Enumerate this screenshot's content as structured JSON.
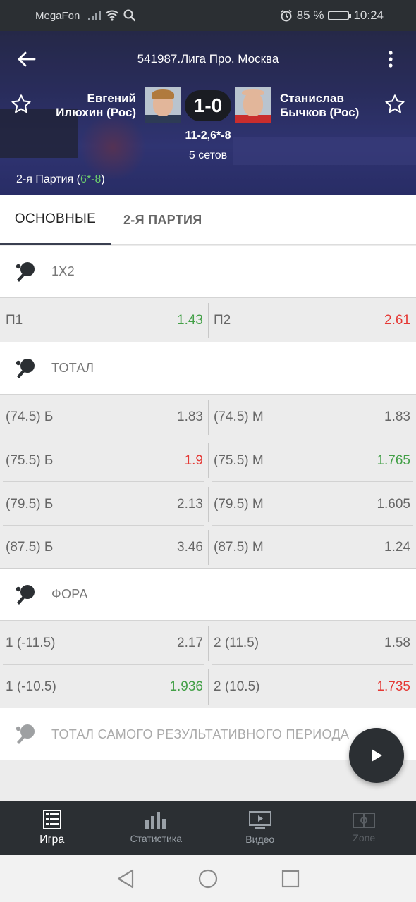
{
  "status_bar": {
    "carrier": "MegaFon",
    "battery": "85 %",
    "time": "10:24",
    "battery_level": 0.85
  },
  "header": {
    "title": "541987.Лига Про. Москва",
    "team1_line1": "Евгений",
    "team1_line2": "Илюхин (Рос)",
    "team2_line1": "Станислав",
    "team2_line2": "Бычков (Рос)",
    "score": "1-0",
    "sets_score": "11-2,6*-8",
    "sets_count": "5 сетов",
    "period_prefix": "2-я Партия (",
    "period_a": "6*",
    "period_sep": "-",
    "period_b": "8",
    "period_suffix": ")"
  },
  "tabs": [
    {
      "label": "ОСНОВНЫЕ",
      "active": true
    },
    {
      "label": "2-Я ПАРТИЯ",
      "active": false
    }
  ],
  "sections": {
    "x12": {
      "title": "1X2",
      "rows": [
        {
          "left_name": "П1",
          "left_odd": "1.43",
          "right_name": "П2",
          "right_odd": "2.61"
        }
      ]
    },
    "total": {
      "title": "ТОТАЛ",
      "rows": [
        {
          "left_name": "(74.5) Б",
          "left_odd": "1.83",
          "right_name": "(74.5) М",
          "right_odd": "1.83"
        },
        {
          "left_name": "(75.5) Б",
          "left_odd": "1.9",
          "right_name": "(75.5) М",
          "right_odd": "1.765"
        },
        {
          "left_name": "(79.5) Б",
          "left_odd": "2.13",
          "right_name": "(79.5) М",
          "right_odd": "1.605"
        },
        {
          "left_name": "(87.5) Б",
          "left_odd": "3.46",
          "right_name": "(87.5) М",
          "right_odd": "1.24"
        }
      ]
    },
    "fora": {
      "title": "ФОРА",
      "rows": [
        {
          "left_name": "1 (-11.5)",
          "left_odd": "2.17",
          "right_name": "2 (11.5)",
          "right_odd": "1.58"
        },
        {
          "left_name": "1 (-10.5)",
          "left_odd": "1.936",
          "right_name": "2 (10.5)",
          "right_odd": "1.735"
        }
      ]
    },
    "total_top_period": {
      "title": "ТОТАЛ САМОГО РЕЗУЛЬТАТИВНОГО ПЕРИОДА"
    }
  },
  "bottom_nav": [
    {
      "label": "Игра",
      "icon": "game-icon",
      "active": true
    },
    {
      "label": "Статистика",
      "icon": "stats-icon",
      "active": false
    },
    {
      "label": "Видео",
      "icon": "video-icon",
      "active": false
    },
    {
      "label": "Zone",
      "icon": "zone-icon",
      "active": false
    }
  ],
  "colors": {
    "up": "#43a047",
    "down": "#e53935",
    "header_bg": "#31356b",
    "nav_bg": "#2b2f33"
  }
}
